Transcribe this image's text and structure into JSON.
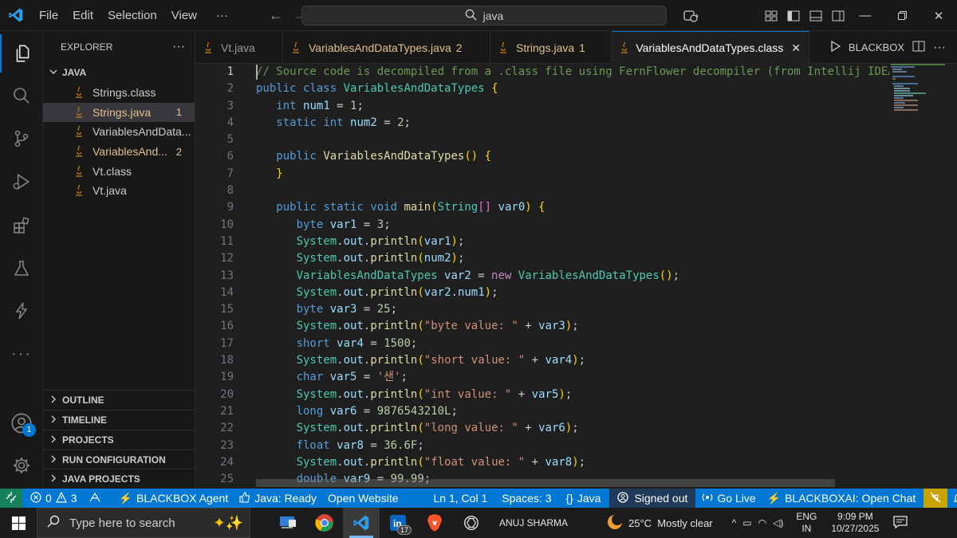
{
  "titlebar": {
    "menus": [
      "File",
      "Edit",
      "Selection",
      "View"
    ],
    "more": "···",
    "search_value": "java"
  },
  "sidebar": {
    "header": "EXPLORER",
    "more": "···",
    "folder": "JAVA",
    "files": [
      {
        "name": "Strings.class",
        "badge": "",
        "modified": false,
        "selected": false
      },
      {
        "name": "Strings.java",
        "badge": "1",
        "modified": true,
        "selected": true
      },
      {
        "name": "VariablesAndData...",
        "badge": "",
        "modified": false,
        "selected": false
      },
      {
        "name": "VariablesAnd...",
        "badge": "2",
        "modified": true,
        "selected": false
      },
      {
        "name": "Vt.class",
        "badge": "",
        "modified": false,
        "selected": false
      },
      {
        "name": "Vt.java",
        "badge": "",
        "modified": false,
        "selected": false
      }
    ],
    "sections": [
      "OUTLINE",
      "TIMELINE",
      "PROJECTS",
      "RUN CONFIGURATION",
      "JAVA PROJECTS"
    ]
  },
  "activity_badge": "1",
  "tabs": [
    {
      "label": "Vt.java",
      "count": ""
    },
    {
      "label": "VariablesAndDataTypes.java",
      "count": "2"
    },
    {
      "label": "Strings.java",
      "count": "1"
    },
    {
      "label": "VariablesAndDataTypes.class",
      "count": ""
    }
  ],
  "tab_actions": {
    "blackbox": "BLACKBOX",
    "more": "···"
  },
  "editor": {
    "line_numbers": [
      "1",
      "2",
      "3",
      "4",
      "5",
      "6",
      "7",
      "8",
      "9",
      "10",
      "11",
      "12",
      "13",
      "14",
      "15",
      "16",
      "17",
      "18",
      "19",
      "20",
      "21",
      "22",
      "23",
      "24",
      "25"
    ],
    "lines": [
      "// Source code is decompiled from a .class file using FernFlower decompiler (from Intellij IDEA).",
      "public class VariablesAndDataTypes {",
      "   int num1 = 1;",
      "   static int num2 = 2;",
      "",
      "   public VariablesAndDataTypes() {",
      "   }",
      "",
      "   public static void main(String[] var0) {",
      "      byte var1 = 3;",
      "      System.out.println(var1);",
      "      System.out.println(num2);",
      "      VariablesAndDataTypes var2 = new VariablesAndDataTypes();",
      "      System.out.println(var2.num1);",
      "      byte var3 = 25;",
      "      System.out.println(\"byte value: \" + var3);",
      "      short var4 = 1500;",
      "      System.out.println(\"short value: \" + var4);",
      "      char var5 = '샌';",
      "      System.out.println(\"int value: \" + var5);",
      "      long var6 = 9876543210L;",
      "      System.out.println(\"long value: \" + var6);",
      "      float var8 = 36.6F;",
      "      System.out.println(\"float value: \" + var8);",
      "      double var9 = 99.99;"
    ]
  },
  "statusbar": {
    "errors": "0",
    "warnings": "3",
    "blackbox_agent": "BLACKBOX Agent",
    "java_ready": "Java: Ready",
    "open_website": "Open Website",
    "position": "Ln 1, Col 1",
    "spaces": "Spaces: 3",
    "language": "Java",
    "signed_out": "Signed out",
    "go_live": "Go Live",
    "blackbox_ai": "BLACKBOXAI: Open Chat"
  },
  "taskbar": {
    "search_placeholder": "Type here to search",
    "linkedin_badge": "17",
    "user": "ANUJ SHARMA",
    "weather": "25°C  Mostly clear",
    "lang_top": "ENG",
    "lang_bottom": "IN",
    "time": "9:09 PM",
    "date": "10/27/2025"
  },
  "colors": {
    "accent": "#0078d4",
    "modified": "#e2c08d",
    "status_remote": "#16825d",
    "warning_bg": "#c9a400"
  }
}
